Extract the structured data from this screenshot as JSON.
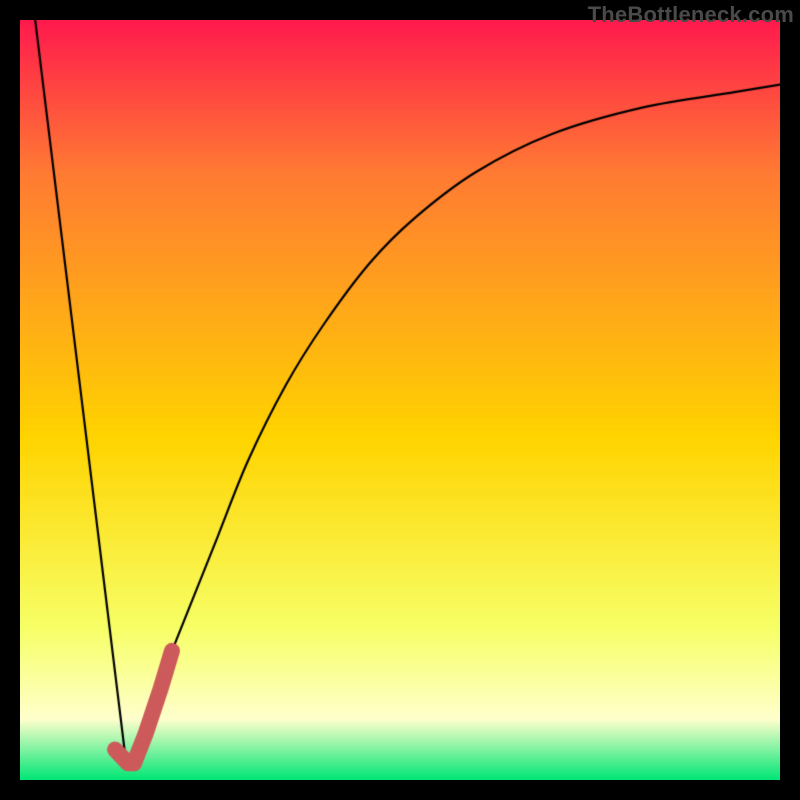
{
  "watermark": {
    "text": "TheBottleneck.com"
  },
  "colors": {
    "frame": "#000000",
    "grad_top": "#ff1a4d",
    "grad_mid_upper": "#ff7a33",
    "grad_mid": "#ffd400",
    "grad_lower": "#f7ff66",
    "grad_pale": "#ffffcc",
    "grad_bottom": "#00e676",
    "curve": "#000000",
    "highlight": "#cc5a5a"
  },
  "chart_data": {
    "type": "line",
    "title": "",
    "xlabel": "",
    "ylabel": "",
    "xlim": [
      0,
      100
    ],
    "ylim": [
      0,
      100
    ],
    "grid": false,
    "legend": false,
    "series": [
      {
        "name": "left-descent",
        "x": [
          2,
          14
        ],
        "values": [
          100,
          2
        ]
      },
      {
        "name": "right-curve",
        "x": [
          14,
          18,
          22,
          26,
          30,
          35,
          40,
          46,
          52,
          60,
          70,
          82,
          94,
          100
        ],
        "values": [
          2,
          12,
          22,
          32,
          42,
          52,
          60,
          68,
          74,
          80,
          85,
          88.5,
          90.5,
          91.5
        ]
      },
      {
        "name": "highlight-j",
        "x": [
          12.5,
          14.2,
          15.0,
          16.5,
          18.5,
          20.0
        ],
        "values": [
          4.0,
          2.2,
          2.2,
          6.0,
          12.0,
          17.0
        ]
      }
    ],
    "gradient_stops": [
      {
        "pos": 0.0,
        "color_key": "grad_top"
      },
      {
        "pos": 0.2,
        "color_key": "grad_mid_upper"
      },
      {
        "pos": 0.55,
        "color_key": "grad_mid"
      },
      {
        "pos": 0.8,
        "color_key": "grad_lower"
      },
      {
        "pos": 0.92,
        "color_key": "grad_pale"
      },
      {
        "pos": 1.0,
        "color_key": "grad_bottom"
      }
    ]
  }
}
